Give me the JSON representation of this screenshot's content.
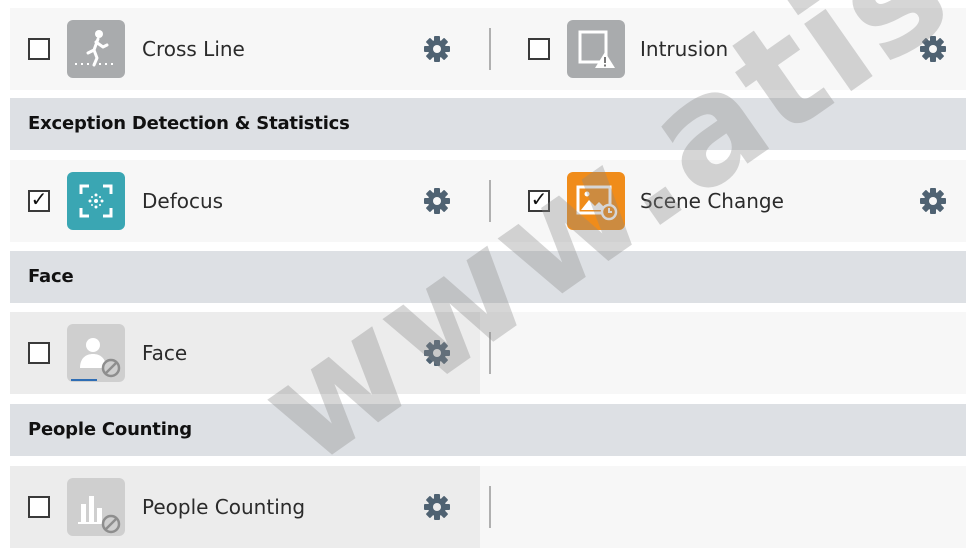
{
  "rows": [
    {
      "type": "items",
      "left": {
        "label": "Cross Line",
        "checked": false,
        "icon": "cross-line-icon",
        "icon_color": "#a9abad"
      },
      "right": {
        "label": "Intrusion",
        "checked": false,
        "icon": "intrusion-icon",
        "icon_color": "#a9abad"
      }
    },
    {
      "type": "header",
      "label": "Exception Detection & Statistics"
    },
    {
      "type": "items",
      "left": {
        "label": "Defocus",
        "checked": true,
        "icon": "defocus-icon",
        "icon_color": "#3aa6b3"
      },
      "right": {
        "label": "Scene Change",
        "checked": true,
        "icon": "scene-change-icon",
        "icon_color": "#f08c1a"
      }
    },
    {
      "type": "header",
      "label": "Face"
    },
    {
      "type": "items",
      "left": {
        "label": "Face",
        "checked": false,
        "icon": "face-disabled-icon",
        "icon_color": "#cfcfcf"
      }
    },
    {
      "type": "header",
      "label": "People Counting"
    },
    {
      "type": "items",
      "left": {
        "label": "People Counting",
        "checked": false,
        "icon": "people-counting-disabled-icon",
        "icon_color": "#cfcfcf"
      }
    }
  ],
  "colors": {
    "header_bg": "#dde0e4",
    "row_bg": "#f7f7f7",
    "gear": "#4f6272",
    "watermark": "#8a8a8a"
  },
  "watermark_text": "www.atis-secu"
}
